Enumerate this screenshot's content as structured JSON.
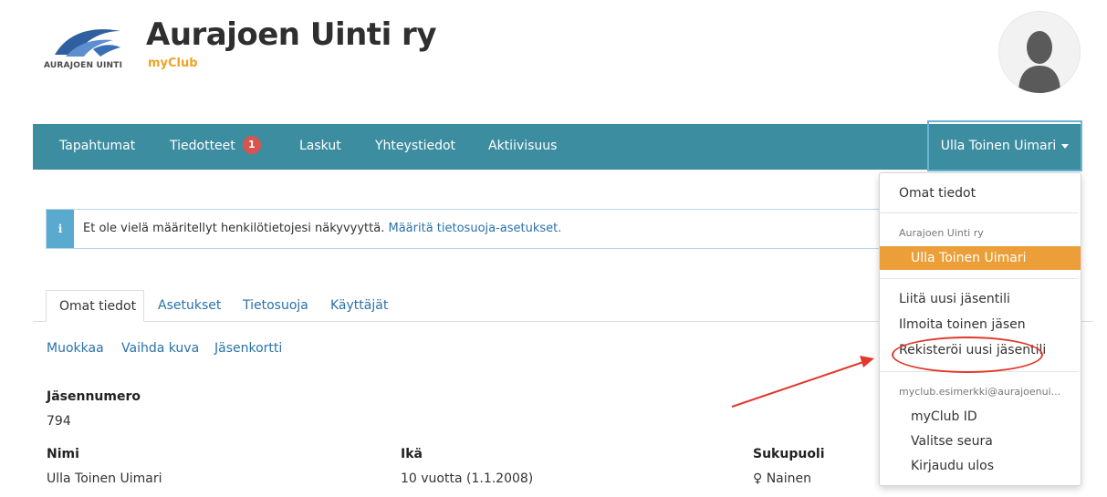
{
  "header": {
    "logo_text": "AURAJOEN UINTI",
    "club_name": "Aurajoen Uinti ry",
    "app_name": "myClub"
  },
  "nav": {
    "items": [
      {
        "label": "Tapahtumat"
      },
      {
        "label": "Tiedotteet",
        "badge": "1"
      },
      {
        "label": "Laskut"
      },
      {
        "label": "Yhteystiedot"
      },
      {
        "label": "Aktiivisuus"
      }
    ],
    "user_menu_label": "Ulla Toinen Uimari"
  },
  "alert": {
    "icon": "i",
    "text": "Et ole vielä määritellyt henkilötietojesi näkyvyyttä.",
    "link": "Määritä tietosuoja-asetukset."
  },
  "tabs": [
    {
      "label": "Omat tiedot",
      "active": true
    },
    {
      "label": "Asetukset"
    },
    {
      "label": "Tietosuoja"
    },
    {
      "label": "Käyttäjät"
    }
  ],
  "actions": [
    "Muokkaa",
    "Vaihda kuva",
    "Jäsenkortti"
  ],
  "profile": {
    "member_number_label": "Jäsennumero",
    "member_number": "794",
    "name_label": "Nimi",
    "name": "Ulla Toinen Uimari",
    "age_label": "Ikä",
    "age": "10 vuotta (1.1.2008)",
    "gender_label": "Sukupuoli",
    "gender": "♀ Nainen"
  },
  "dropdown": {
    "own_info": "Omat tiedot",
    "club_header": "Aurajoen Uinti ry",
    "selected_member": "Ulla Toinen Uimari",
    "link_account": "Liitä uusi jäsentili",
    "report_member": "Ilmoita toinen jäsen",
    "register_account": "Rekisteröi uusi jäsentili",
    "email_header": "myclub.esimerkki@aurajoenui...",
    "myclub_id": "myClub ID",
    "choose_club": "Valitse seura",
    "logout": "Kirjaudu ulos"
  },
  "colors": {
    "navbar": "#3d8da0",
    "accent": "#f0a324",
    "selected": "#ec9f39",
    "link": "#2a72a8",
    "badge": "#d9534f",
    "annotation": "#e03a2d"
  }
}
